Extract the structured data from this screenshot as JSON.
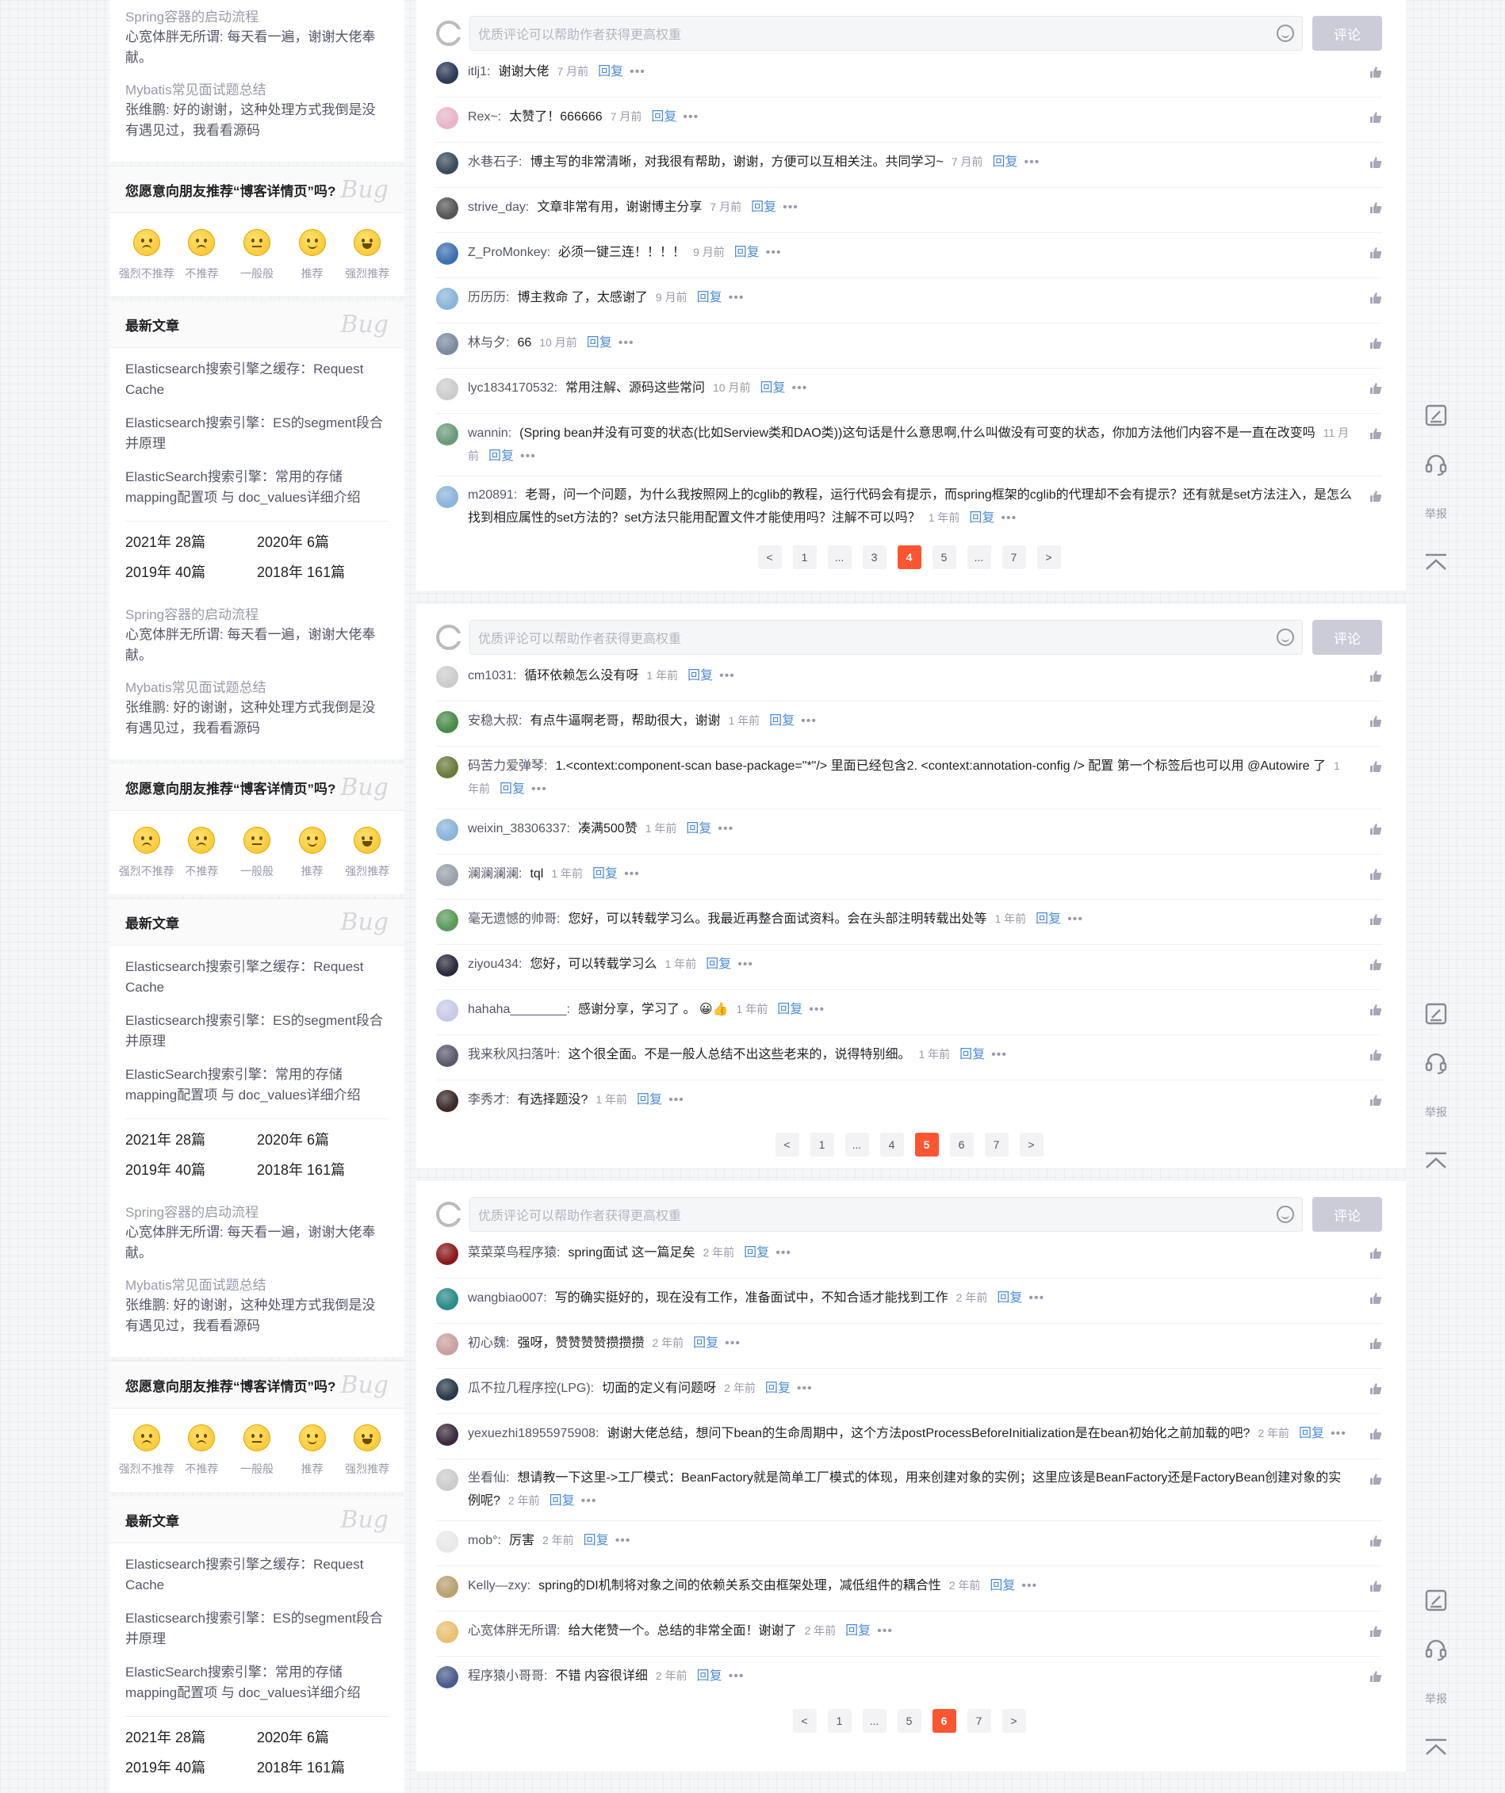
{
  "sidebar": {
    "recent_comments": [
      {
        "title": "Spring容器的启动流程",
        "text": "心宽体胖无所谓: 每天看一遍，谢谢大佬奉献。"
      },
      {
        "title": "Mybatis常见面试题总结",
        "text": "张维鹏: 好的谢谢，这种处理方式我倒是没有遇见过，我看看源码"
      }
    ],
    "recommend": {
      "title": "您愿意向朋友推荐“博客详情页”吗?",
      "options": [
        "强烈不推荐",
        "不推荐",
        "一般般",
        "推荐",
        "强烈推荐"
      ]
    },
    "latest": {
      "title": "最新文章",
      "articles": [
        "Elasticsearch搜索引擎之缓存：Request Cache",
        "Elasticsearch搜索引擎：ES的segment段合并原理",
        "ElasticSearch搜索引擎：常用的存储mapping配置项 与 doc_values详细介绍"
      ],
      "archive": [
        "2021年  28篇",
        "2020年  6篇",
        "2019年  40篇",
        "2018年  161篇"
      ]
    },
    "bug_mark": "Bug"
  },
  "comment_box": {
    "placeholder": "优质评论可以帮助作者获得更高权重",
    "submit_label": "评论"
  },
  "reply_label": "回复",
  "more_label": "•••",
  "report_label": "举报",
  "panels": [
    {
      "comments": [
        {
          "user": "itlj1:",
          "text": "谢谢大佬",
          "time": "7 月前",
          "color": "#2b3a55"
        },
        {
          "user": "Rex~:",
          "text": "太赞了！666666",
          "time": "7 月前",
          "color": "#e8b4c8"
        },
        {
          "user": "水巷石子:",
          "text": "博主写的非常清晰，对我很有帮助，谢谢，方便可以互相关注。共同学习~",
          "time": "7 月前",
          "color": "#3a4a5c"
        },
        {
          "user": "strive_day:",
          "text": "文章非常有用，谢谢博主分享",
          "time": "7 月前",
          "color": "#555"
        },
        {
          "user": "Z_ProMonkey:",
          "text": "必须一键三连！！！！",
          "time": "9 月前",
          "color": "#3c6fb0"
        },
        {
          "user": "历历历:",
          "text": "博主救命 了，太感谢了",
          "time": "9 月前",
          "color": "#8ab4d8"
        },
        {
          "user": "林与夕:",
          "text": "66",
          "time": "10 月前",
          "color": "#7a8aa0"
        },
        {
          "user": "lyc1834170532:",
          "text": "常用注解、源码这些常问",
          "time": "10 月前",
          "color": "#cccccc"
        },
        {
          "user": "wannin:",
          "text": "(Spring bean并没有可变的状态(比如Serview类和DAO类))这句话是什么意思啊,什么叫做没有可变的状态，你加方法他们内容不是一直在改变吗",
          "time": "11 月前",
          "color": "#6a9a7a"
        },
        {
          "user": "m20891:",
          "text": "老哥，问一个问题，为什么我按照网上的cglib的教程，运行代码会有提示，而spring框架的cglib的代理却不会有提示？还有就是set方法注入，是怎么找到相应属性的set方法的？set方法只能用配置文件才能使用吗？注解不可以吗？",
          "time": "1 年前",
          "color": "#8ab4d8"
        }
      ],
      "pages": [
        "<",
        "1",
        "...",
        "3",
        "4",
        "5",
        "...",
        "7",
        ">"
      ],
      "active_page": "4"
    },
    {
      "comments": [
        {
          "user": "cm1031:",
          "text": "循环依赖怎么没有呀",
          "time": "1 年前",
          "color": "#cccccc"
        },
        {
          "user": "安稳大叔:",
          "text": "有点牛逼啊老哥，帮助很大，谢谢",
          "time": "1 年前",
          "color": "#4a8a4a"
        },
        {
          "user": "码苦力爱弹琴:",
          "text": "1.<context:component-scan base-package=\"*\"/> 里面已经包含2. <context:annotation-config /> 配置 第一个标签后也可以用 @Autowire 了",
          "time": "1 年前",
          "color": "#6a7a3a"
        },
        {
          "user": "weixin_38306337:",
          "text": "凑满500赞",
          "time": "1 年前",
          "color": "#8ab4d8"
        },
        {
          "user": "澜澜澜澜:",
          "text": "tql",
          "time": "1 年前",
          "color": "#9aa0a8"
        },
        {
          "user": "毫无遗憾的帅哥:",
          "text": "您好，可以转载学习么。我最近再整合面试资料。会在头部注明转载出处等",
          "time": "1 年前",
          "color": "#5a9a5a"
        },
        {
          "user": "ziyou434:",
          "text": "您好，可以转载学习么",
          "time": "1 年前",
          "color": "#2a2a3a"
        },
        {
          "user": "hahaha________:",
          "text": "感谢分享，学习了 。 😀👍",
          "time": "1 年前",
          "color": "#c8c8e8"
        },
        {
          "user": "我来秋风扫落叶:",
          "text": "这个很全面。不是一般人总结不出这些老来的，说得特别细。",
          "time": "1 年前",
          "color": "#5a5a6a"
        },
        {
          "user": "李秀才:",
          "text": "有选择题没?",
          "time": "1 年前",
          "color": "#3a2a2a"
        }
      ],
      "pages": [
        "<",
        "1",
        "...",
        "4",
        "5",
        "6",
        "7",
        ">"
      ],
      "active_page": "5"
    },
    {
      "comments": [
        {
          "user": "菜菜菜鸟程序猿:",
          "text": "spring面试 这一篇足矣",
          "time": "2 年前",
          "color": "#8a1a1a"
        },
        {
          "user": "wangbiao007:",
          "text": "写的确实挺好的，现在没有工作，准备面试中，不知合适才能找到工作",
          "time": "2 年前",
          "color": "#2a8a8a"
        },
        {
          "user": "初心魏:",
          "text": "强呀，赞赞赞赞攒攒攒",
          "time": "2 年前",
          "color": "#c8a0a0"
        },
        {
          "user": "瓜不拉几程序控(LPG):",
          "text": "切面的定义有问题呀",
          "time": "2 年前",
          "color": "#2a3a4a"
        },
        {
          "user": "yexuezhi18955975908:",
          "text": "谢谢大佬总结，想问下bean的生命周期中，这个方法postProcessBeforeInitialization是在bean初始化之前加载的吧?",
          "time": "2 年前",
          "color": "#3a2a3a"
        },
        {
          "user": "坐看仙:",
          "text": "想请教一下这里->工厂模式：BeanFactory就是简单工厂模式的体现，用来创建对象的实例；这里应该是BeanFactory还是FactoryBean创建对象的实例呢?",
          "time": "2 年前",
          "color": "#cccccc"
        },
        {
          "user": "mob°:",
          "text": "厉害",
          "time": "2 年前",
          "color": "#e8e8e8"
        },
        {
          "user": "Kelly—zxy:",
          "text": "spring的DI机制将对象之间的依赖关系交由框架处理，减低组件的耦合性",
          "time": "2 年前",
          "color": "#b8a070"
        },
        {
          "user": "心宽体胖无所谓:",
          "text": "给大佬赞一个。总结的非常全面！谢谢了",
          "time": "2 年前",
          "color": "#e8c070"
        },
        {
          "user": "程序猿小哥哥:",
          "text": "不错 内容很详细",
          "time": "2 年前",
          "color": "#4a5a8a"
        }
      ],
      "pages": [
        "<",
        "1",
        "...",
        "5",
        "6",
        "7",
        ">"
      ],
      "active_page": "6"
    }
  ]
}
